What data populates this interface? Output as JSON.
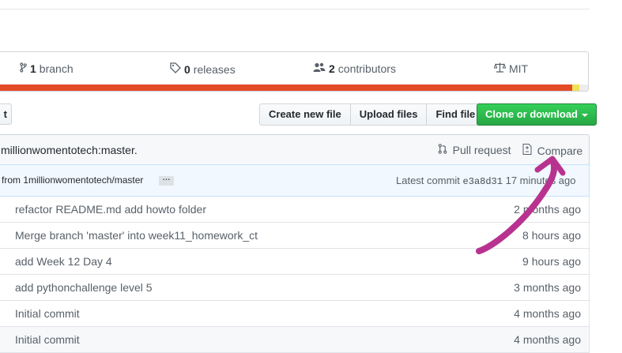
{
  "numbers": {
    "branch_count": "1",
    "branch_label": "branch",
    "releases_count": "0",
    "releases_label": "releases",
    "contributors_count": "2",
    "contributors_label": "contributors",
    "license": "MIT",
    "language_colors": [
      "#e34c26",
      "#f1e05a",
      "#ededed"
    ]
  },
  "toolbar": {
    "left_button_fragment": "t",
    "create_file": "Create new file",
    "upload_files": "Upload files",
    "find_file": "Find file",
    "clone": "Clone or download"
  },
  "branch_info": {
    "text": "millionwomentotech:master.",
    "pull_request": "Pull request",
    "compare": "Compare"
  },
  "latest_commit": {
    "message": "from 1millionwomentotech/master",
    "ellipsis": "…",
    "label": "Latest commit",
    "sha": "e3a8d31",
    "time": "17 minutes ago"
  },
  "files": [
    {
      "message": "refactor README.md add howto folder",
      "age": "2 months ago"
    },
    {
      "message": "Merge branch 'master' into week11_homework_ct",
      "age": "8 hours ago"
    },
    {
      "message": "add Week 12 Day 4",
      "age": "9 hours ago"
    },
    {
      "message": "add pythonchallenge level 5",
      "age": "3 months ago"
    },
    {
      "message": "Initial commit",
      "age": "4 months ago"
    },
    {
      "message": "Initial commit",
      "age": "4 months ago"
    }
  ],
  "annotation_color": "#b8338f"
}
